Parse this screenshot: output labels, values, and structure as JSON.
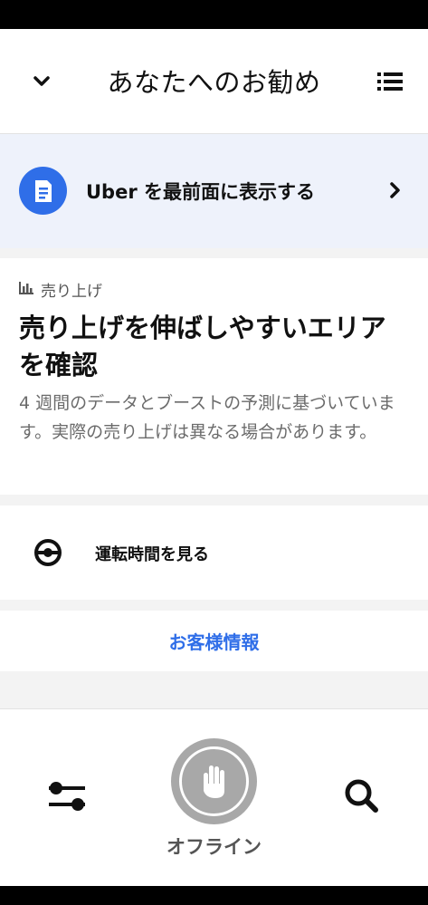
{
  "header": {
    "title": "あなたへのお勧め",
    "collapse_icon": "chevron-down-icon",
    "menu_icon": "list-icon"
  },
  "promo": {
    "icon": "document-icon",
    "label": "Uber を最前面に表示する",
    "arrow_icon": "chevron-right-icon",
    "accent": "#2f6ee8"
  },
  "earnings_card": {
    "kicker_icon": "bar-chart-icon",
    "kicker": "売り上げ",
    "headline": "売り上げを伸ばしやすいエリアを確認",
    "body": "4 週間のデータとブーストの予測に基づいています。実際の売り上げは異なる場合があります。"
  },
  "drive_time": {
    "icon": "steering-wheel-icon",
    "label": "運転時間を見る"
  },
  "customer_info": {
    "label": "お客様情報"
  },
  "bottom_bar": {
    "filters_icon": "sliders-icon",
    "offline_icon": "hand-icon",
    "offline_label": "オフライン",
    "search_icon": "search-icon"
  }
}
